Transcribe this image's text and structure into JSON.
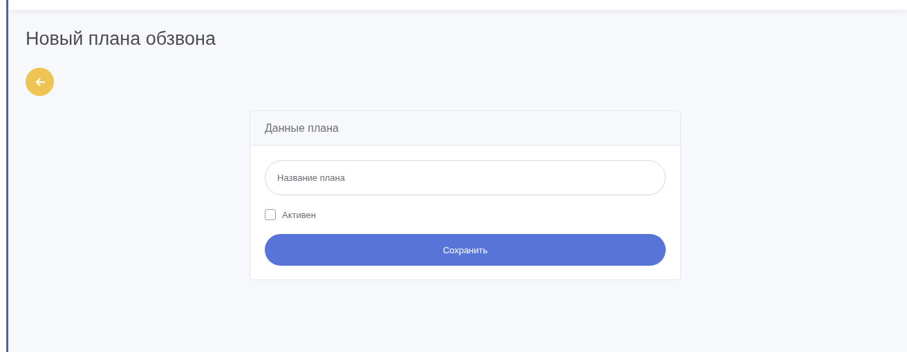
{
  "page": {
    "title": "Новый плана обзвона"
  },
  "card": {
    "title": "Данные плана",
    "name_field": {
      "placeholder": "Название плана"
    },
    "active": {
      "label": "Активен",
      "checked": false
    },
    "save_button": {
      "label": "Сохранить"
    }
  }
}
